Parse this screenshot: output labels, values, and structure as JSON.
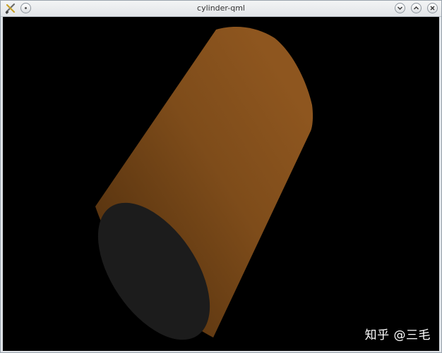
{
  "window": {
    "title": "cylinder-qml",
    "icons": {
      "app": "tools-icon",
      "menu": "window-menu-icon",
      "minimize": "chevron-down-icon",
      "maximize": "chevron-up-icon",
      "close": "close-icon"
    }
  },
  "scene": {
    "object": "cylinder",
    "background_color": "#000000",
    "body_color_light": "#8a541d",
    "body_color_dark": "#5a3510",
    "cap_color": "#1c1c1c"
  },
  "watermark": {
    "text": "知乎 @三毛"
  }
}
